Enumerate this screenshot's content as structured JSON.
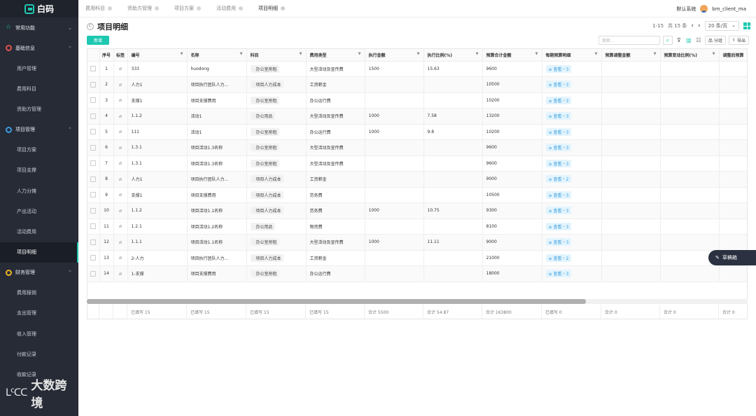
{
  "app": {
    "logo_text": "白码"
  },
  "sidebar": {
    "groups": [
      {
        "label": "常用功能",
        "icon": "star-icon",
        "color": "#1ec8b0",
        "expanded": false,
        "items": []
      },
      {
        "label": "基础信息",
        "icon": "circle-icon",
        "color": "#e0524a",
        "expanded": true,
        "items": [
          "用户管理",
          "费用科目",
          "资助方管理"
        ]
      },
      {
        "label": "项目管理",
        "icon": "circle-icon",
        "color": "#3a9ee0",
        "expanded": true,
        "items": [
          "项目方案",
          "项目支撑",
          "人力分摊",
          "产出活动",
          "活动费用",
          "项目明细"
        ]
      },
      {
        "label": "财务管理",
        "icon": "circle-icon",
        "color": "#f0b429",
        "expanded": true,
        "items": [
          "费用报销",
          "支出管理",
          "收入管理",
          "付款记录",
          "收款记录"
        ]
      }
    ],
    "active_item": "项目明细",
    "watermark": "大数跨境",
    "watermark_logo": "ᒪᑦᑕᑕ"
  },
  "tabs": [
    {
      "label": "费用科目",
      "active": false
    },
    {
      "label": "资助方管理",
      "active": false
    },
    {
      "label": "项目方案",
      "active": false
    },
    {
      "label": "活动费用",
      "active": false
    },
    {
      "label": "项目明细",
      "active": true
    }
  ],
  "topbar": {
    "system": "默认系统",
    "username": "bm_client_ma"
  },
  "page": {
    "title": "项目明细",
    "pager_range": "1-15",
    "pager_total": "共 15 条",
    "page_size": "20 条/页",
    "add_label": "新增",
    "search_placeholder": "搜索...",
    "group_label": "分组",
    "export_label": "导出"
  },
  "table": {
    "columns": [
      "序号",
      "标签",
      "编号",
      "名称",
      "科目",
      "费用类型",
      "执行金额",
      "执行比例(%)",
      "预算合计金额",
      "每期预算明细",
      "预算调整金额",
      "预算变动比例(%)",
      "调整后预算"
    ],
    "rows": [
      {
        "no": "1",
        "code": "333",
        "name": "huodong",
        "subject": "办公室房租",
        "type": "大型活动及宣传费",
        "amount": "1500",
        "ratio": "15.63",
        "budget": "9600",
        "detail": "查看・3"
      },
      {
        "no": "2",
        "code": "人力1",
        "name": "项目执行团队人力...",
        "subject": "项目人力成本",
        "type": "工资薪金",
        "amount": "",
        "ratio": "",
        "budget": "10500",
        "detail": "查看・3"
      },
      {
        "no": "3",
        "code": "支撑1",
        "name": "项目支撑费用",
        "subject": "办公室房租",
        "type": "办公运行费",
        "amount": "",
        "ratio": "",
        "budget": "10200",
        "detail": "查看・3"
      },
      {
        "no": "4",
        "code": "1.1.2",
        "name": "活动1",
        "subject": "办公用品",
        "type": "大型活动及宣传费",
        "amount": "1000",
        "ratio": "7.58",
        "budget": "13200",
        "detail": "查看・3"
      },
      {
        "no": "5",
        "code": "111",
        "name": "活动1",
        "subject": "办公室房租",
        "type": "办公运行费",
        "amount": "1000",
        "ratio": "9.8",
        "budget": "10200",
        "detail": "查看・3"
      },
      {
        "no": "6",
        "code": "1.3.1",
        "name": "项目活动1.3名称",
        "subject": "办公室房租",
        "type": "大型活动及宣传费",
        "amount": "",
        "ratio": "",
        "budget": "9600",
        "detail": "查看・3"
      },
      {
        "no": "7",
        "code": "1.3.1",
        "name": "项目活动1.3名称",
        "subject": "办公室房租",
        "type": "大型活动及宣传费",
        "amount": "",
        "ratio": "",
        "budget": "9600",
        "detail": "查看・3"
      },
      {
        "no": "8",
        "code": "人力1",
        "name": "项目执行团队人力...",
        "subject": "项目人力成本",
        "type": "工资薪金",
        "amount": "",
        "ratio": "",
        "budget": "9000",
        "detail": "查看・2"
      },
      {
        "no": "9",
        "code": "支撑1",
        "name": "项目支撑费用",
        "subject": "项目人力成本",
        "type": "劳务费",
        "amount": "",
        "ratio": "",
        "budget": "10500",
        "detail": "查看・3"
      },
      {
        "no": "10",
        "code": "1.1.2",
        "name": "项目活动1.1名称",
        "subject": "项目人力成本",
        "type": "劳务费",
        "amount": "1000",
        "ratio": "10.75",
        "budget": "9300",
        "detail": "查看・3"
      },
      {
        "no": "11",
        "code": "1.2.1",
        "name": "项目活动1.2名称",
        "subject": "办公用品",
        "type": "物资费",
        "amount": "",
        "ratio": "",
        "budget": "8100",
        "detail": "查看・3"
      },
      {
        "no": "12",
        "code": "1.1.1",
        "name": "项目活动1.1名称",
        "subject": "办公室房租",
        "type": "大型活动及宣传费",
        "amount": "1000",
        "ratio": "11.11",
        "budget": "9000",
        "detail": "查看・3"
      },
      {
        "no": "13",
        "code": "2-人力",
        "name": "项目执行团队人力...",
        "subject": "项目人力成本",
        "type": "工资薪金",
        "amount": "",
        "ratio": "",
        "budget": "21000",
        "detail": "查看・2"
      },
      {
        "no": "14",
        "code": "1-支撑",
        "name": "项目支撑费用",
        "subject": "办公室房租",
        "type": "办公运行费",
        "amount": "",
        "ratio": "",
        "budget": "18000",
        "detail": "查看・3"
      }
    ],
    "footer": [
      "已填写 15",
      "已填写 15",
      "已填写 15",
      "已填写 15",
      "合计 5500",
      "合计 54.87",
      "合计 163800",
      "已填写 0",
      "合计 0",
      "合计 0",
      "合计 0"
    ]
  },
  "drafts_label": "草稿箱"
}
